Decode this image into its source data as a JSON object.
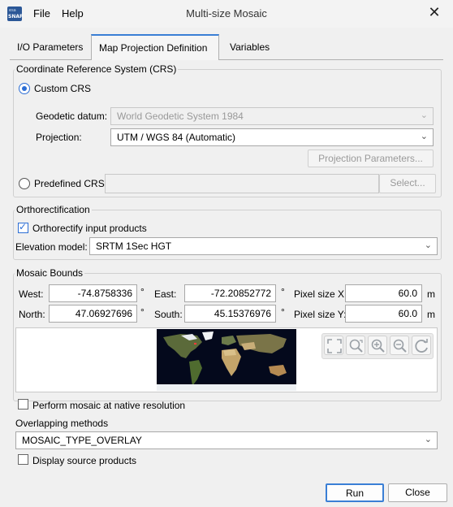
{
  "window": {
    "title": "Multi-size Mosaic",
    "close_glyph": "✕"
  },
  "menu": {
    "file": "File",
    "help": "Help"
  },
  "logo": {
    "top": "esa",
    "bottom": "SNAP"
  },
  "tabs": [
    {
      "label": "I/O Parameters",
      "active": false
    },
    {
      "label": "Map Projection Definition",
      "active": true
    },
    {
      "label": "Variables",
      "active": false
    }
  ],
  "crs": {
    "group_label": "Coordinate Reference System (CRS)",
    "custom_label": "Custom CRS",
    "custom_selected": true,
    "datum_label": "Geodetic datum:",
    "datum_value": "World Geodetic System 1984",
    "projection_label": "Projection:",
    "projection_value": "UTM / WGS 84 (Automatic)",
    "projection_params_button": "Projection Parameters...",
    "predefined_label": "Predefined CRS",
    "predefined_value": "",
    "select_button": "Select..."
  },
  "ortho": {
    "group_label": "Orthorectification",
    "checkbox_label": "Orthorectify input products",
    "checked": true,
    "elevation_label": "Elevation model:",
    "elevation_value": "SRTM 1Sec HGT"
  },
  "bounds": {
    "group_label": "Mosaic Bounds",
    "west_label": "West:",
    "west_value": "-74.8758336",
    "east_label": "East:",
    "east_value": "-72.20852772",
    "north_label": "North:",
    "north_value": "47.06927696",
    "south_label": "South:",
    "south_value": "45.15376976",
    "degree": "°",
    "pixel_x_label": "Pixel size X:",
    "pixel_x_value": "60.0",
    "pixel_y_label": "Pixel size Y:",
    "pixel_y_value": "60.0",
    "unit": "m"
  },
  "native_res": {
    "label": "Perform mosaic at native resolution",
    "checked": false
  },
  "overlap": {
    "label": "Overlapping methods",
    "value": "MOSAIC_TYPE_OVERLAY"
  },
  "display_source": {
    "label": "Display source products",
    "checked": false
  },
  "buttons": {
    "run": "Run",
    "close": "Close"
  },
  "colors": {
    "accent": "#3a7fd5",
    "map_bg": "#04091c"
  },
  "icons": [
    "zoom-all-icon",
    "zoom-tool-icon",
    "zoom-in-icon",
    "zoom-out-icon",
    "sync-icon",
    "chevron-down-icon"
  ]
}
